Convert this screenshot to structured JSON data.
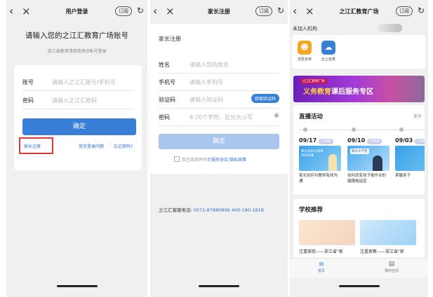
{
  "common": {
    "subscribe_label": "订阅"
  },
  "login": {
    "title": "用户登录",
    "heading": "请输入您的之江汇教育广场账号",
    "subtitle": "浙江省教师请使用师训账号登录",
    "account_label": "账号",
    "account_placeholder": "请输入之江汇账号/手机号",
    "password_label": "密码",
    "password_placeholder": "请输入之江汇密码",
    "confirm_label": "确定",
    "parent_register": "家长注册",
    "faq": "常见登录问题",
    "forgot": "忘记密码?",
    "colors": {
      "primary": "#3a7fd7",
      "highlight_box": "#e53935"
    }
  },
  "register": {
    "title": "家长注册",
    "section_title": "家长注册",
    "fields": [
      {
        "label": "姓名",
        "placeholder": "请输入您的姓名"
      },
      {
        "label": "手机号",
        "placeholder": "请输入手机号"
      },
      {
        "label": "验证码",
        "placeholder": "请输入验证码"
      },
      {
        "label": "密码",
        "placeholder": "8-20个字符，区分大小写"
      }
    ],
    "get_code": "获取验证码",
    "confirm_label": "确定",
    "agree_text": "我已阅读并同意",
    "agreement_link": "服务协议",
    "privacy_link": "隐私政策",
    "hotline_label": "之江汇客服电话:",
    "hotline_numbers": "0571-87880806  400-180-1818",
    "colors": {
      "button_disabled": "#a9c6ee"
    }
  },
  "plaza": {
    "title": "之江汇教育广场",
    "org_status": "未加入机构",
    "apps": [
      {
        "label": "志愿全体",
        "icon": "team-icon",
        "color": "#f5a623"
      },
      {
        "label": "云上名校",
        "icon": "cloud-school-icon",
        "color": "#3a7fd7"
      }
    ],
    "banner_small": "之江汇教育广场",
    "banner_text_1": "义务教育",
    "banner_text_2": "课后服务专区",
    "live_title": "直播活动",
    "live_more": "更多",
    "live_items": [
      {
        "date": "09/17",
        "tag": "已结束",
        "thumb_title": "家长如何与教师有效沟通",
        "caption": "家长如何与教师有效沟通"
      },
      {
        "date": "09/10",
        "tag": "已结束",
        "thumb_title": "家长大学堂",
        "caption": "如何改变孩子拖作业的磨蹭拖延症"
      },
      {
        "date": "09/03",
        "tag": "已结束",
        "thumb_title": "",
        "caption": "掌握亲子"
      }
    ],
    "school_title": "学校推荐",
    "school_items": [
      {
        "caption": "注重家庭——浙江省\"家"
      },
      {
        "caption": "注重家教——浙江省\"家"
      }
    ],
    "tabs": [
      {
        "label": "首页",
        "icon": "home-icon",
        "active": true
      },
      {
        "label": "我的空间",
        "icon": "book-icon",
        "active": false
      }
    ]
  }
}
